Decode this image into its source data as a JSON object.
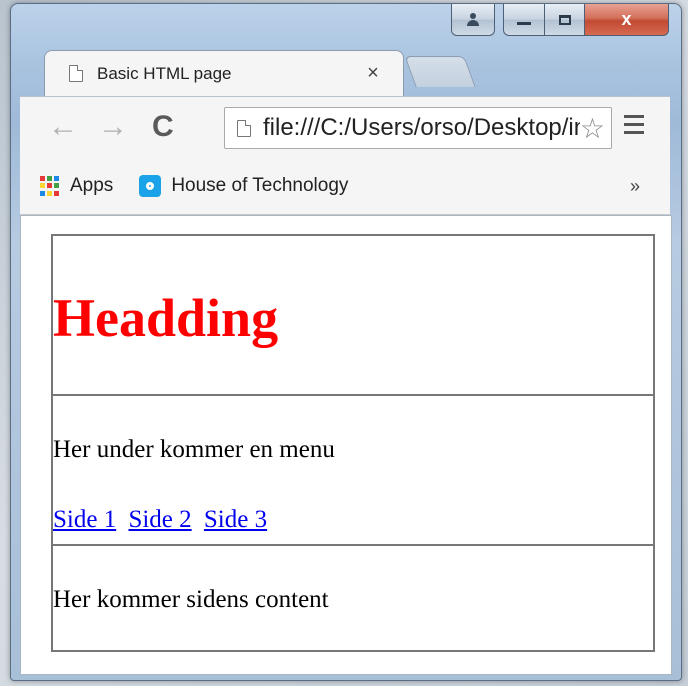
{
  "window": {
    "controls": {
      "user": "user-icon",
      "minimize": "minimize-icon",
      "maximize": "maximize-icon",
      "close": "x"
    }
  },
  "tab": {
    "title": "Basic HTML page",
    "close": "×"
  },
  "toolbar": {
    "back": "←",
    "forward": "→",
    "reload": "C",
    "url": "file:///C:/Users/orso/Desktop/index.html",
    "star": "☆"
  },
  "bookmarks": {
    "apps_label": "Apps",
    "items": [
      {
        "label": "House of Technology"
      }
    ],
    "overflow": "»"
  },
  "page": {
    "heading": "Headding",
    "heading_color": "#ff0000",
    "menu_intro": "Her under kommer en menu",
    "links": [
      {
        "label": "Side 1"
      },
      {
        "label": "Side 2"
      },
      {
        "label": "Side 3"
      }
    ],
    "content_text": "Her kommer sidens content"
  }
}
